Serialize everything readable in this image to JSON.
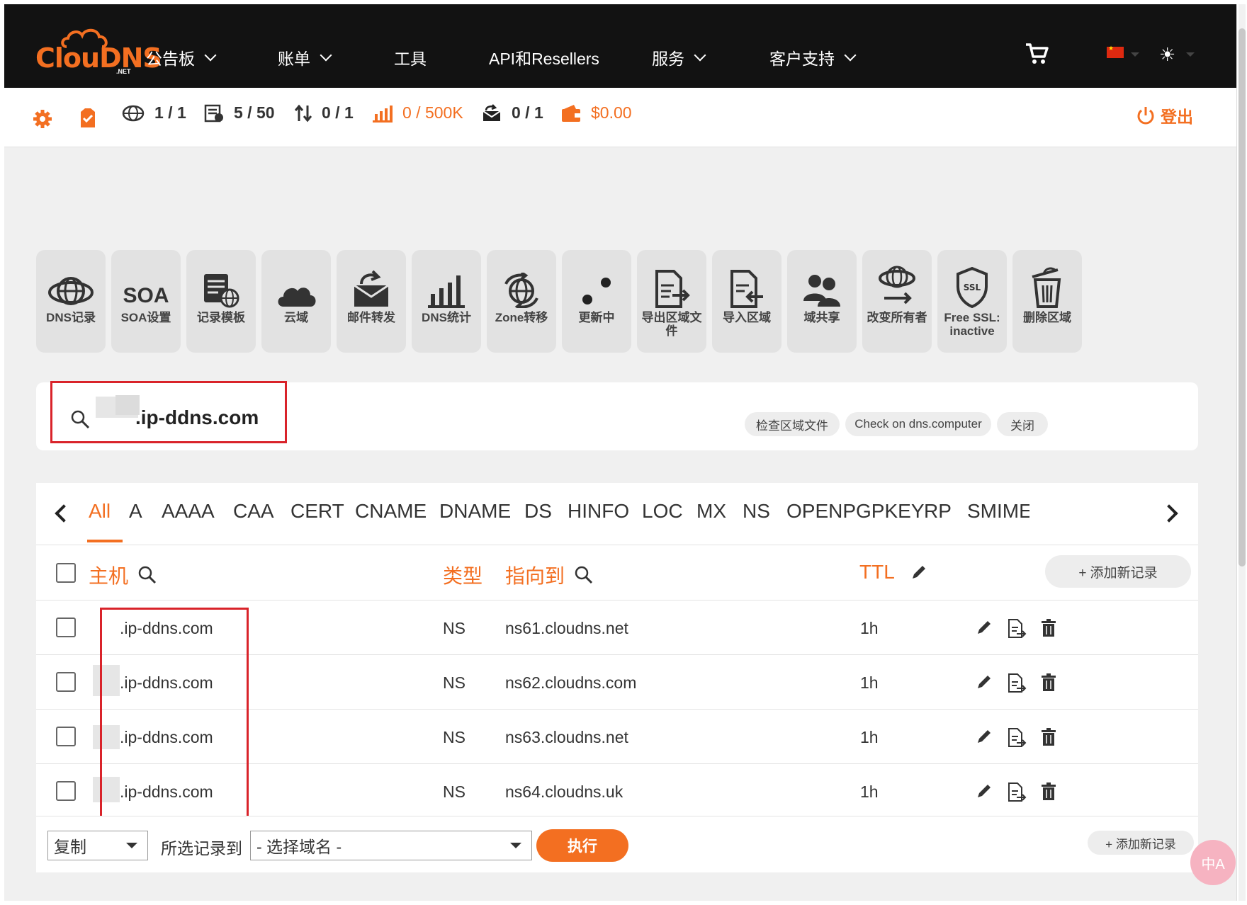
{
  "nav": {
    "logo_text": "ClouDNS",
    "logo_sub": ".NET",
    "items": [
      "公告板",
      "账单",
      "工具",
      "API和Resellers",
      "服务",
      "客户支持"
    ]
  },
  "stats": {
    "zones": "1 / 1",
    "records": "5 / 50",
    "transfers": "0 / 1",
    "queries": "0 / 500K",
    "mail": "0 / 1",
    "balance": "$0.00",
    "logout": "登出"
  },
  "tiles": [
    {
      "label": "DNS记录",
      "icon": "globe-icon"
    },
    {
      "label": "SOA设置",
      "icon": "soa-text-icon",
      "glyph": "SOA"
    },
    {
      "label": "记录模板",
      "icon": "template-icon"
    },
    {
      "label": "云域",
      "icon": "cloud-icon"
    },
    {
      "label": "邮件转发",
      "icon": "mail-forward-icon"
    },
    {
      "label": "DNS统计",
      "icon": "bar-chart-icon"
    },
    {
      "label": "Zone转移",
      "icon": "zone-transfer-icon"
    },
    {
      "label": "更新中",
      "icon": "dots-icon"
    },
    {
      "label": "导出区域文件",
      "icon": "export-file-icon"
    },
    {
      "label": "导入区域",
      "icon": "import-file-icon"
    },
    {
      "label": "域共享",
      "icon": "users-icon"
    },
    {
      "label": "改变所有者",
      "icon": "change-owner-icon"
    },
    {
      "label": "Free SSL: inactive",
      "icon": "ssl-shield-icon",
      "glyph": "SSL"
    },
    {
      "label": "删除区域",
      "icon": "trash-icon"
    }
  ],
  "zone": {
    "name": ".ip-ddns.com",
    "check_zone": "检查区域文件",
    "check_dns": "Check on dns.computer",
    "close": "关闭"
  },
  "record_tabs": [
    "All",
    "A",
    "AAAA",
    "CAA",
    "CERT",
    "CNAME",
    "DNAME",
    "DS",
    "HINFO",
    "LOC",
    "MX",
    "NS",
    "OPENPGPKEY",
    "RP",
    "SMIME/"
  ],
  "table": {
    "col_host": "主机",
    "col_type": "类型",
    "col_points": "指向到",
    "col_ttl": "TTL",
    "add_record": "+ 添加新记录",
    "rows": [
      {
        "host": ".ip-ddns.com",
        "type": "NS",
        "points_to": "ns61.cloudns.net",
        "ttl": "1h"
      },
      {
        "host": ".ip-ddns.com",
        "type": "NS",
        "points_to": "ns62.cloudns.com",
        "ttl": "1h"
      },
      {
        "host": ".ip-ddns.com",
        "type": "NS",
        "points_to": "ns63.cloudns.net",
        "ttl": "1h"
      },
      {
        "host": ".ip-ddns.com",
        "type": "NS",
        "points_to": "ns64.cloudns.uk",
        "ttl": "1h"
      }
    ]
  },
  "bottom": {
    "action_select": "复制",
    "label": "所选记录到",
    "domain_select": "- 选择域名 -",
    "execute": "执行",
    "add_record": "+ 添加新记录"
  },
  "fab": "中A",
  "colors": {
    "accent": "#f36f21",
    "nav_bg": "#121212",
    "highlight": "#d9232a"
  }
}
